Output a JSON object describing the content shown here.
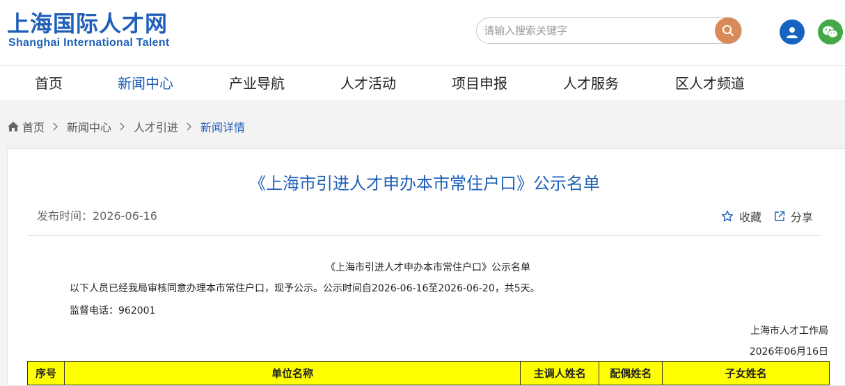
{
  "header": {
    "logo_cn": "上海国际人才网",
    "logo_en": "Shanghai International Talent",
    "search_placeholder": "请输入搜索关键字",
    "icons": {
      "search": "search-icon",
      "user": "user-icon",
      "wechat": "wechat-icon"
    },
    "colors": {
      "brand": "#1f5fb8",
      "search_button": "#d98b57",
      "user": "#1565c0",
      "wechat": "#43a847"
    }
  },
  "nav": {
    "items": [
      {
        "label": "首页"
      },
      {
        "label": "新闻中心",
        "active": true
      },
      {
        "label": "产业导航"
      },
      {
        "label": "人才活动"
      },
      {
        "label": "项目申报"
      },
      {
        "label": "人才服务"
      },
      {
        "label": "区人才频道"
      }
    ]
  },
  "breadcrumb": {
    "items": [
      "首页",
      "新闻中心",
      "人才引进",
      "新闻详情"
    ],
    "icon": "home-icon"
  },
  "article": {
    "title": "《上海市引进人才申办本市常住户口》公示名单",
    "pubtime": "发布时间：2026-06-16",
    "favorite_label": "收藏",
    "share_label": "分享",
    "body": {
      "doc_title": "《上海市引进人才申办本市常住户口》公示名单",
      "line1": "以下人员已经我局审核同意办理本市常住户口，现予公示。公示时间自2026-06-16至2026-06-20，共5天。",
      "line2": "监督电话：962001",
      "org": "上海市人才工作局",
      "date": "2026年06月16日"
    },
    "table": {
      "headers": [
        "序号",
        "单位名称",
        "主调人姓名",
        "配偶姓名",
        "子女姓名"
      ],
      "header_color": "#ffff00"
    }
  }
}
